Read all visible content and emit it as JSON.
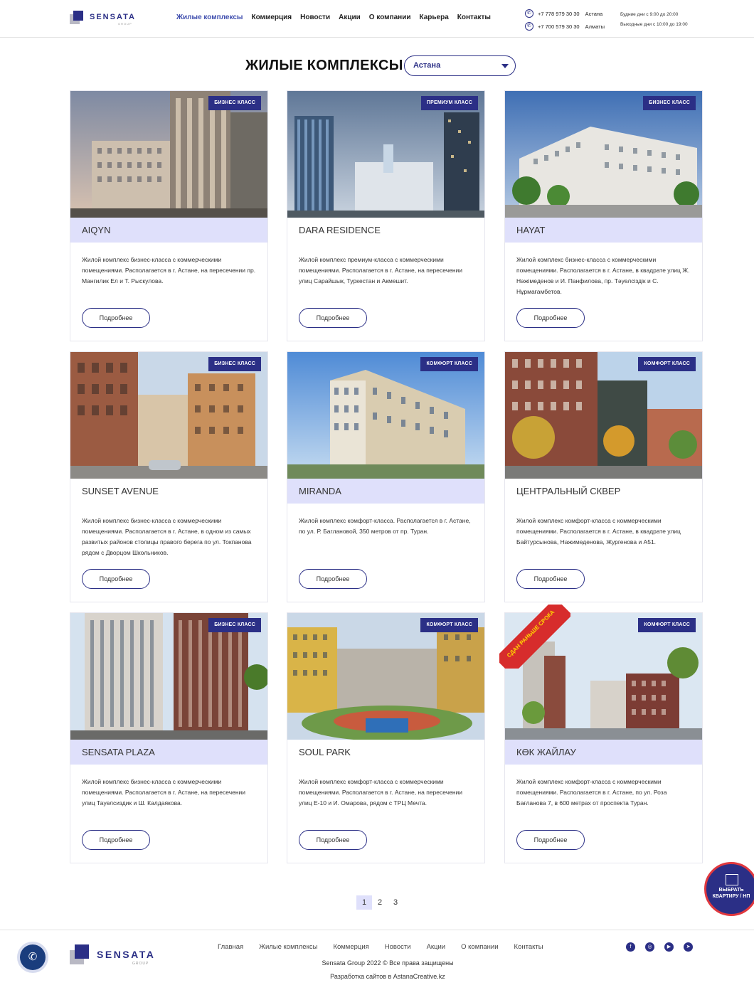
{
  "header": {
    "logo_text": "SENSATA",
    "logo_sub": "GROUP",
    "nav": [
      "Жилые комплексы",
      "Коммерция",
      "Новости",
      "Акции",
      "О компании",
      "Карьера",
      "Контакты"
    ],
    "phones": [
      {
        "number": "+7 778 979 30 30",
        "city": "Астана"
      },
      {
        "number": "+7 700 579 30 30",
        "city": "Алматы"
      }
    ],
    "hours_weekdays": "Будние дни с 9:00 до 20:00",
    "hours_weekend": "Выходные дни с 10:00 до 19:00"
  },
  "main": {
    "title": "ЖИЛЫЕ КОМПЛЕКСЫ",
    "city_select": "Астана",
    "more_label": "Подробнее",
    "cards": [
      {
        "name": "AIQYN",
        "badge": "БИЗНЕС КЛАСС",
        "desc": "Жилой комплекс бизнес-класса с коммерческими помещениями. Располагается в г. Астане, на пересечении пр. Мангилик Ел и Т. Рыскулова."
      },
      {
        "name": "DARA RESIDENCE",
        "badge": "ПРЕМИУМ КЛАСС",
        "desc": "Жилой комплекс премиум-класса с коммерческими помещениями. Располагается в г. Астане, на пересечении улиц Сарайшык, Туркестан и Акмешит."
      },
      {
        "name": "HAYAT",
        "badge": "БИЗНЕС КЛАСС",
        "desc": "Жилой комплекс бизнес-класса с коммерческими помещениями. Располагается в г. Астане, в квадрате улиц Ж. Нәжімеденов и И. Панфилова, пр. Тәуелсіздік и С. Нұрмағамбетов."
      },
      {
        "name": "SUNSET AVENUE",
        "badge": "БИЗНЕС КЛАСС",
        "desc": "Жилой комплекс бизнес-класса с коммерческими помещениями. Располагается в г. Астане, в одном из самых развитых районов столицы правого берега по ул. Токпанова рядом с Дворцом Школьников."
      },
      {
        "name": "MIRANDA",
        "badge": "КОМФОРТ КЛАСС",
        "desc": "Жилой комплекс комфорт-класса. Располагается в г. Астане, по ул. Р. Баглановой, 350 метров от пр. Туран."
      },
      {
        "name": "ЦЕНТРАЛЬНЫЙ СКВЕР",
        "badge": "КОМФОРТ КЛАСС",
        "desc": "Жилой комплекс комфорт-класса с коммерческими помещениями. Располагается в г. Астане, в квадрате улиц Байтурсынова, Нажимеденова, Жургенова и А51."
      },
      {
        "name": "SENSATA PLAZA",
        "badge": "БИЗНЕС КЛАСС",
        "desc": "Жилой комплекс бизнес-класса с коммерческими помещениями. Располагается в г. Астане, на пересечении улиц Тауелсиздик и Ш. Калдаякова."
      },
      {
        "name": "SOUL PARK",
        "badge": "КОМФОРТ КЛАСС",
        "desc": "Жилой комплекс комфорт-класса с коммерческими помещениями. Располагается в г. Астане, на пересечении улиц Е-10 и И. Омарова, рядом с ТРЦ Мечта."
      },
      {
        "name": "КӨК ЖАЙЛАУ",
        "badge": "КОМФОРТ КЛАСС",
        "desc": "Жилой комплекс комфорт-класса с коммерческими помещениями. Располагается в г. Астане, по ул. Роза Бағланова 7, в 600 метрах от проспекта Туран.",
        "ribbon": "СДАН РАНЬШЕ СРОКА"
      }
    ],
    "pages": [
      "1",
      "2",
      "3"
    ]
  },
  "float_button": "ВЫБРАТЬ КВАРТИРУ / НП",
  "footer": {
    "logo_text": "SENSATA",
    "logo_sub": "GROUP",
    "nav": [
      "Главная",
      "Жилые комплексы",
      "Коммерция",
      "Новости",
      "Акции",
      "О компании",
      "Контакты"
    ],
    "copyright": "Sensata Group 2022 © Все права защищены",
    "developer": "Разработка сайтов в AstanaCreative.kz"
  },
  "colors": {
    "brand": "#2b2f86",
    "highlight": "#dfe0fb",
    "accent_red": "#e0383e"
  }
}
